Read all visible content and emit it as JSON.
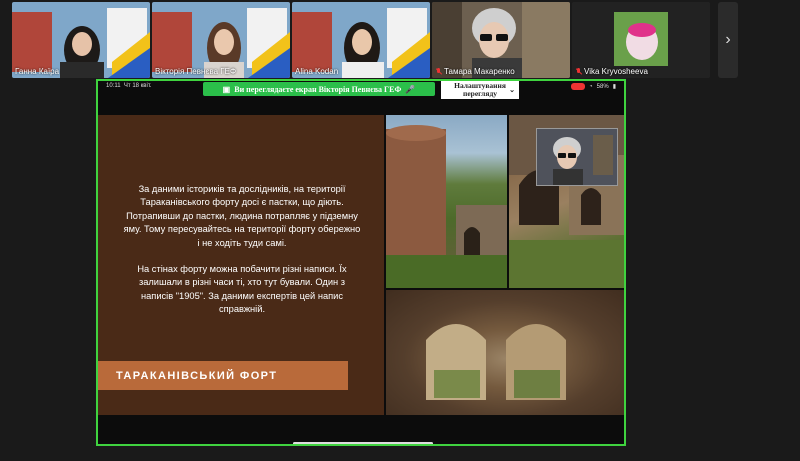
{
  "participants": [
    {
      "name": "Ганна Каїра",
      "muted": false
    },
    {
      "name": "Вікторія Певнєва ГЕФ",
      "muted": false
    },
    {
      "name": "Alina Kodan",
      "muted": false
    },
    {
      "name": "Тамара Макаренко",
      "muted": true
    },
    {
      "name": "Vika Kryvosheeva",
      "muted": true
    }
  ],
  "share": {
    "banner": "Ви переглядаєте екран Вікторія Певнєва ГЕФ",
    "view_options": "Налаштування перегляду",
    "status_time": "10:11",
    "status_date": "Чт 18 квіт.",
    "battery": "58%"
  },
  "slide": {
    "paragraph1": "За даними істориків та дослідників, на території Тараканівського форту досі є пастки, що діють. Потрапивши до пастки, людина потрапляє у підземну яму. Тому пересувайтесь на території форту обережно і не ходіть туди самі.",
    "paragraph2": "На стінах форту можна побачити різні написи. Їх залишали в різні часи ті, хто тут бували. Один з написів \"1905\". За даними експертів цей напис справжній.",
    "title": "ТАРАКАНІВСЬКИЙ ФОРТ"
  }
}
